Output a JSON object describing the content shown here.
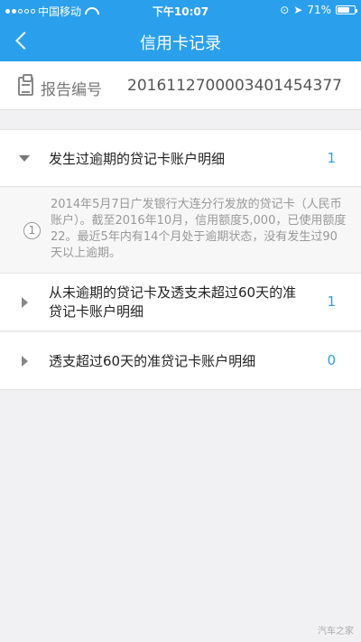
{
  "status_bar": {
    "carrier": "中国移动",
    "time": "下午10:07",
    "battery": "71%",
    "battery_level": 0.71
  },
  "nav": {
    "title": "信用卡记录",
    "back_icon": "chevron-left-icon"
  },
  "report": {
    "icon": "clipboard-icon",
    "label": "报告编号",
    "value": "2016112700003401454377"
  },
  "sections": [
    {
      "title": "发生过逾期的贷记卡账户明细",
      "count": "1",
      "expanded": true,
      "items": [
        {
          "index": "1",
          "text": "2014年5月7日广发银行大连分行发放的贷记卡（人民币账户）。截至2016年10月，信用额度5,000，已使用额度22。最近5年内有14个月处于逾期状态，没有发生过90天以上逾期。"
        }
      ]
    },
    {
      "title_line1": "从未逾期的贷记卡及透支未超过60天的准",
      "title_line2": "贷记卡账户明细",
      "count": "1",
      "expanded": false
    },
    {
      "title": "透支超过60天的准贷记卡账户明细",
      "count": "0",
      "expanded": false
    }
  ],
  "watermark": "汽车之家",
  "colors": {
    "accent": "#2aa0ec",
    "background": "#f1f1f3"
  }
}
